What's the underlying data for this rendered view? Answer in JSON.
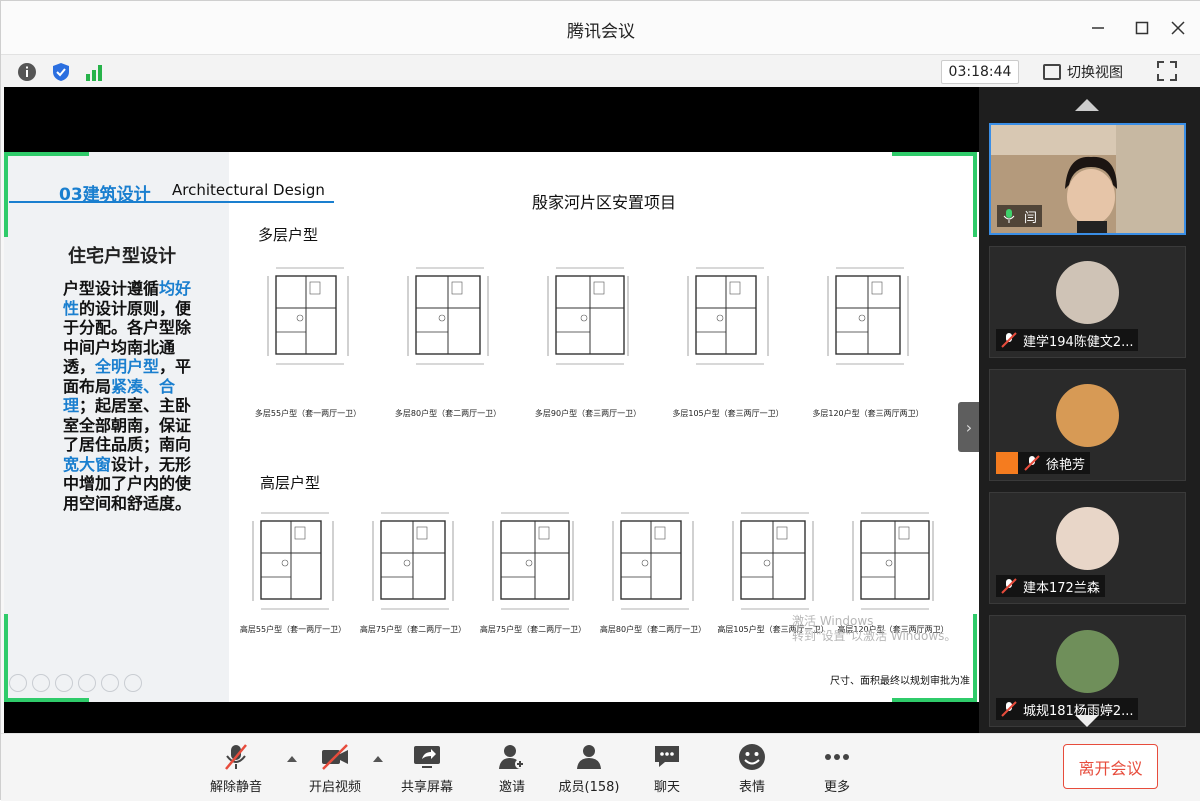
{
  "window": {
    "title": "腾讯会议"
  },
  "toolbar": {
    "timer": "03:18:44",
    "switch_view": "切换视图"
  },
  "slide": {
    "section_title": "03建筑设计",
    "section_subtitle": "Architectural Design",
    "left_heading": "住宅户型设计",
    "left_para": [
      {
        "t": "户型设计遵循",
        "hl": false
      },
      {
        "t": "均好性",
        "hl": true
      },
      {
        "t": "的设计原则，便于分配。各户型除中间户均南北通透，",
        "hl": false
      },
      {
        "t": "全明户型",
        "hl": true
      },
      {
        "t": "，平面布局",
        "hl": false
      },
      {
        "t": "紧凑、合理",
        "hl": true
      },
      {
        "t": "；起居室、主卧室全部朝南，保证了居住品质；南向",
        "hl": false
      },
      {
        "t": "宽大窗",
        "hl": true
      },
      {
        "t": "设计，无形中增加了户内的使用空间和舒适度。",
        "hl": false
      }
    ],
    "project_title": "殷家河片区安置项目",
    "multi_heading": "多层户型",
    "high_heading": "高层户型",
    "multi_plans": [
      "多层55户型（套一两厅一卫）",
      "多层80户型（套二两厅一卫）",
      "多层90户型（套三两厅一卫）",
      "多层105户型（套三两厅一卫）",
      "多层120户型（套三两厅两卫）"
    ],
    "high_plans": [
      "高层55户型（套一两厅一卫）",
      "高层75户型（套二两厅一卫）",
      "高层75户型（套二两厅一卫）",
      "高层80户型（套二两厅一卫）",
      "高层105户型（套三两厅一卫）",
      "高层120户型（套三两厅两卫）"
    ],
    "note": "尺寸、面积最终以规划审批为准",
    "watermark_line1": "激活 Windows",
    "watermark_line2": "转到\"设置\"以激活 Windows。"
  },
  "participants": [
    {
      "name": "闫",
      "mic": "on"
    },
    {
      "name": "建学194陈健文2...",
      "mic": "off"
    },
    {
      "name": "徐艳芳",
      "mic": "off"
    },
    {
      "name": "建本172兰森",
      "mic": "off"
    },
    {
      "name": "城规181杨雨婷2...",
      "mic": "off"
    }
  ],
  "bottom": {
    "unmute": "解除静音",
    "start_video": "开启视频",
    "share_screen": "共享屏幕",
    "invite": "邀请",
    "members": "成员(158)",
    "chat": "聊天",
    "reactions": "表情",
    "more": "更多",
    "leave": "离开会议"
  },
  "colors": {
    "accent": "#1a7fcf",
    "leave_red": "#e74c3c",
    "slide_green": "#2fcb6a"
  }
}
